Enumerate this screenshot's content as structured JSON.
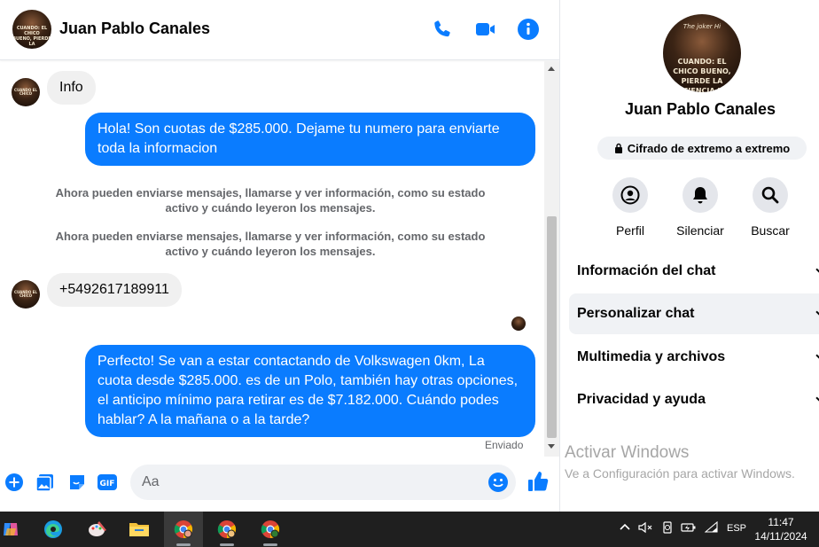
{
  "header": {
    "name": "Juan Pablo Canales",
    "avatar_text": "CUANDO: EL CHICO BUENO, PIERDE LA PACIENCIA"
  },
  "messages": {
    "info_bubble": "Info",
    "out1": "Hola! Son cuotas de $285.000. Dejame tu numero para enviarte toda la informacion",
    "system1": "Ahora pueden enviarse mensajes, llamarse y ver información, como su estado activo y cuándo leyeron los mensajes.",
    "system2": "Ahora pueden enviarse mensajes, llamarse y ver información, como su estado activo y cuándo leyeron los mensajes.",
    "phone_bubble": "+5492617189911",
    "out2": "Perfecto!  Se van a estar contactando de Volkswagen 0km, La cuota desde $285.000. es de un Polo, también hay otras opciones, el anticipo mínimo para retirar es de $7.182.000. Cuándo podes hablar? A la mañana o a la tarde?",
    "status": "Enviado"
  },
  "composer": {
    "placeholder": "Aa"
  },
  "info_panel": {
    "name": "Juan Pablo Canales",
    "avatar_caption_top": "The joker Hi",
    "avatar_caption": "CUANDO: EL CHICO BUENO, PIERDE LA PACIENCIA HIS",
    "encryption": "Cifrado de extremo a extremo",
    "actions": [
      {
        "label": "Perfil",
        "icon": "profile-icon"
      },
      {
        "label": "Silenciar",
        "icon": "bell-icon"
      },
      {
        "label": "Buscar",
        "icon": "search-icon"
      }
    ],
    "sections": [
      {
        "label": "Información del chat",
        "active": false
      },
      {
        "label": "Personalizar chat",
        "active": true
      },
      {
        "label": "Multimedia y archivos",
        "active": false
      },
      {
        "label": "Privacidad y ayuda",
        "active": false
      }
    ]
  },
  "watermark": {
    "title": "Activar Windows",
    "subtitle": "Ve a Configuración para activar Windows."
  },
  "taskbar": {
    "language": "ESP",
    "time": "11:47",
    "date": "14/11/2024",
    "apps": [
      "copilot-icon",
      "edge-icon",
      "paint-icon",
      "file-explorer-icon",
      "chrome-icon",
      "chrome-profile-icon",
      "chrome-profile-t-icon"
    ]
  },
  "colors": {
    "accent": "#0a7cff",
    "incoming_bubble": "#f0f0f0",
    "taskbar": "#1f1f1f"
  }
}
